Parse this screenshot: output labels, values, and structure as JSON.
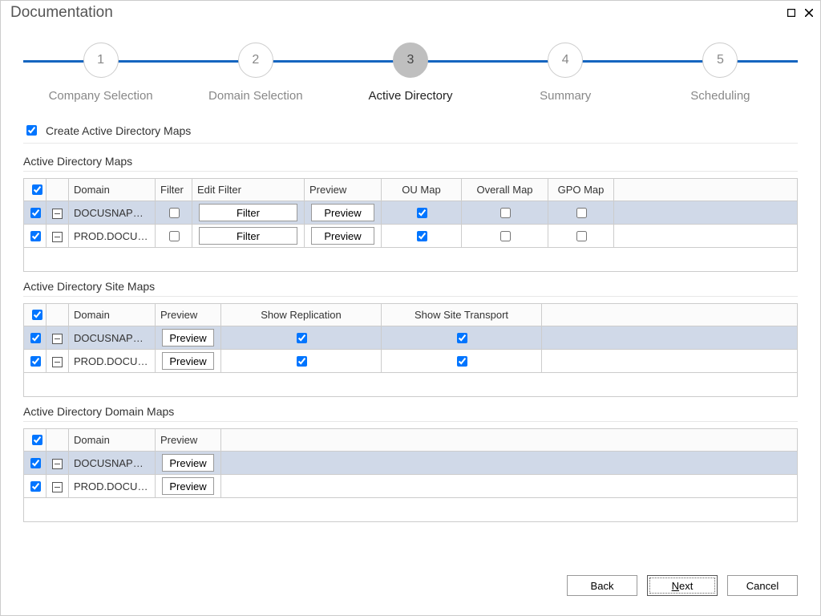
{
  "window": {
    "title": "Documentation"
  },
  "stepper": {
    "steps": [
      {
        "num": "1",
        "label": "Company Selection"
      },
      {
        "num": "2",
        "label": "Domain Selection"
      },
      {
        "num": "3",
        "label": "Active Directory"
      },
      {
        "num": "4",
        "label": "Summary"
      },
      {
        "num": "5",
        "label": "Scheduling"
      }
    ],
    "active_index": 2
  },
  "create_checkbox": {
    "label": "Create Active Directory Maps",
    "checked": true
  },
  "tables": {
    "ad_maps": {
      "title": "Active Directory Maps",
      "columns": [
        "",
        "",
        "Domain",
        "Filter",
        "Edit Filter",
        "Preview",
        "OU Map",
        "Overall Map",
        "GPO Map",
        ""
      ],
      "rows": [
        {
          "sel": true,
          "domain": "DOCUSNAPSP...",
          "filter": false,
          "edit_btn": "Filter",
          "preview_btn": "Preview",
          "ou": true,
          "overall": false,
          "gpo": false
        },
        {
          "sel": true,
          "domain": "PROD.DOCUS...",
          "filter": false,
          "edit_btn": "Filter",
          "preview_btn": "Preview",
          "ou": true,
          "overall": false,
          "gpo": false
        }
      ]
    },
    "site_maps": {
      "title": "Active Directory Site Maps",
      "columns": [
        "",
        "",
        "Domain",
        "Preview",
        "Show Replication",
        "Show Site Transport",
        ""
      ],
      "rows": [
        {
          "sel": true,
          "domain": "DOCUSNAPSP...",
          "preview_btn": "Preview",
          "repl": true,
          "trans": true
        },
        {
          "sel": true,
          "domain": "PROD.DOCUS...",
          "preview_btn": "Preview",
          "repl": true,
          "trans": true
        }
      ]
    },
    "domain_maps": {
      "title": "Active Directory Domain Maps",
      "columns": [
        "",
        "",
        "Domain",
        "Preview",
        ""
      ],
      "rows": [
        {
          "sel": true,
          "domain": "DOCUSNAPSP...",
          "preview_btn": "Preview"
        },
        {
          "sel": true,
          "domain": "PROD.DOCUS...",
          "preview_btn": "Preview"
        }
      ]
    }
  },
  "footer": {
    "back": "Back",
    "next": "Next",
    "cancel": "Cancel"
  }
}
